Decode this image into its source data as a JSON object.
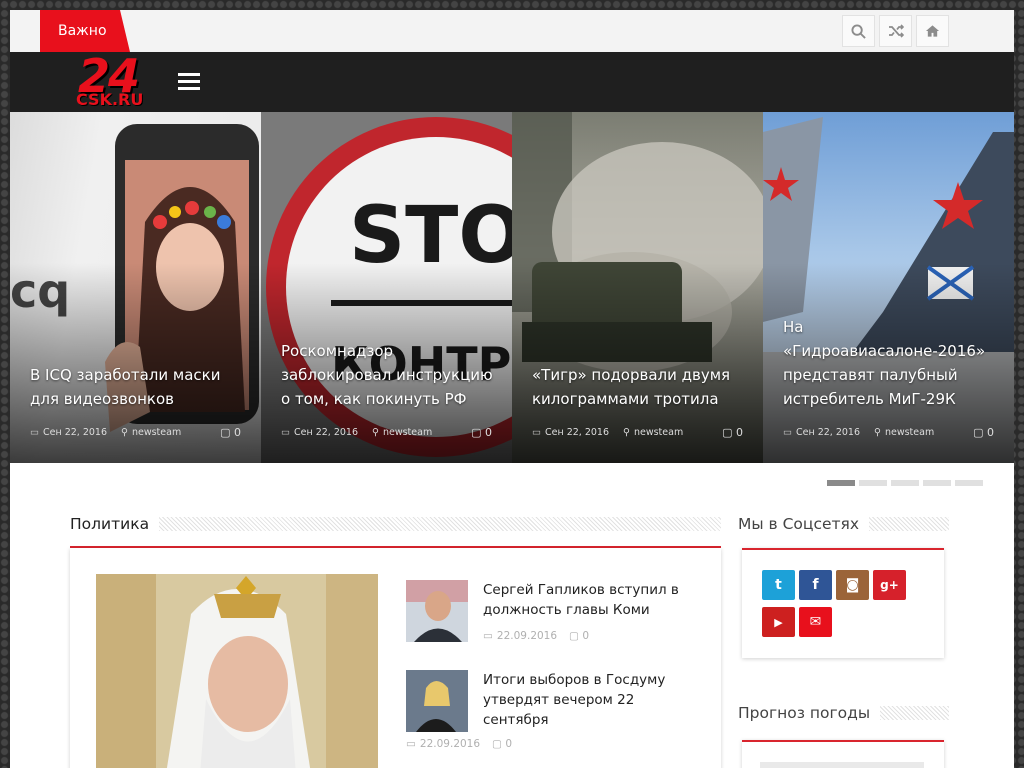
{
  "topbar": {
    "important_label": "Важно",
    "icons": [
      "search-icon",
      "shuffle-icon",
      "home-icon"
    ]
  },
  "header": {
    "logo_number": "24",
    "logo_text": "CSK.RU"
  },
  "slider": {
    "slides": [
      {
        "title": "В ICQ заработали маски для видеозвонков",
        "date": "Сен 22, 2016",
        "author": "newsteam",
        "comments": "0"
      },
      {
        "title": "Роскомнадзор заблокировал инструкцию о том, как покинуть РФ",
        "date": "Сен 22, 2016",
        "author": "newsteam",
        "comments": "0"
      },
      {
        "title": "«Тигр» подорвали двумя килограммами тротила",
        "date": "Сен 22, 2016",
        "author": "newsteam",
        "comments": "0"
      },
      {
        "title": "На «Гидроавиасалоне-2016» представят палубный истребитель МиГ-29К",
        "date": "Сен 22, 2016",
        "author": "newsteam",
        "comments": "0"
      }
    ],
    "pagination_count": 5,
    "active_index": 0
  },
  "politics": {
    "heading": "Политика",
    "items": [
      {
        "title": "Сергей Гапликов вступил в должность главы Коми",
        "date": "22.09.2016",
        "comments": "0"
      },
      {
        "title": "Итоги выборов в Госдуму утвердят вечером 22 сентября",
        "date": "22.09.2016",
        "comments": "0"
      }
    ]
  },
  "social": {
    "heading": "Мы в Соцсетях",
    "buttons": [
      {
        "name": "twitter",
        "glyph": "t",
        "color": "#1da1d8"
      },
      {
        "name": "facebook",
        "glyph": "f",
        "color": "#2f5596"
      },
      {
        "name": "instagram",
        "glyph": "◙",
        "color": "#9b6439"
      },
      {
        "name": "google-plus",
        "glyph": "g+",
        "color": "#d6212b"
      },
      {
        "name": "youtube",
        "glyph": "▶",
        "color": "#cd201f"
      },
      {
        "name": "email",
        "glyph": "✉",
        "color": "#e8101c"
      }
    ]
  },
  "weather": {
    "heading": "Прогноз погоды"
  },
  "colors": {
    "accent": "#e8101c",
    "header_bg": "#1f1f1f",
    "topbar_bg": "#f3f3f3"
  }
}
